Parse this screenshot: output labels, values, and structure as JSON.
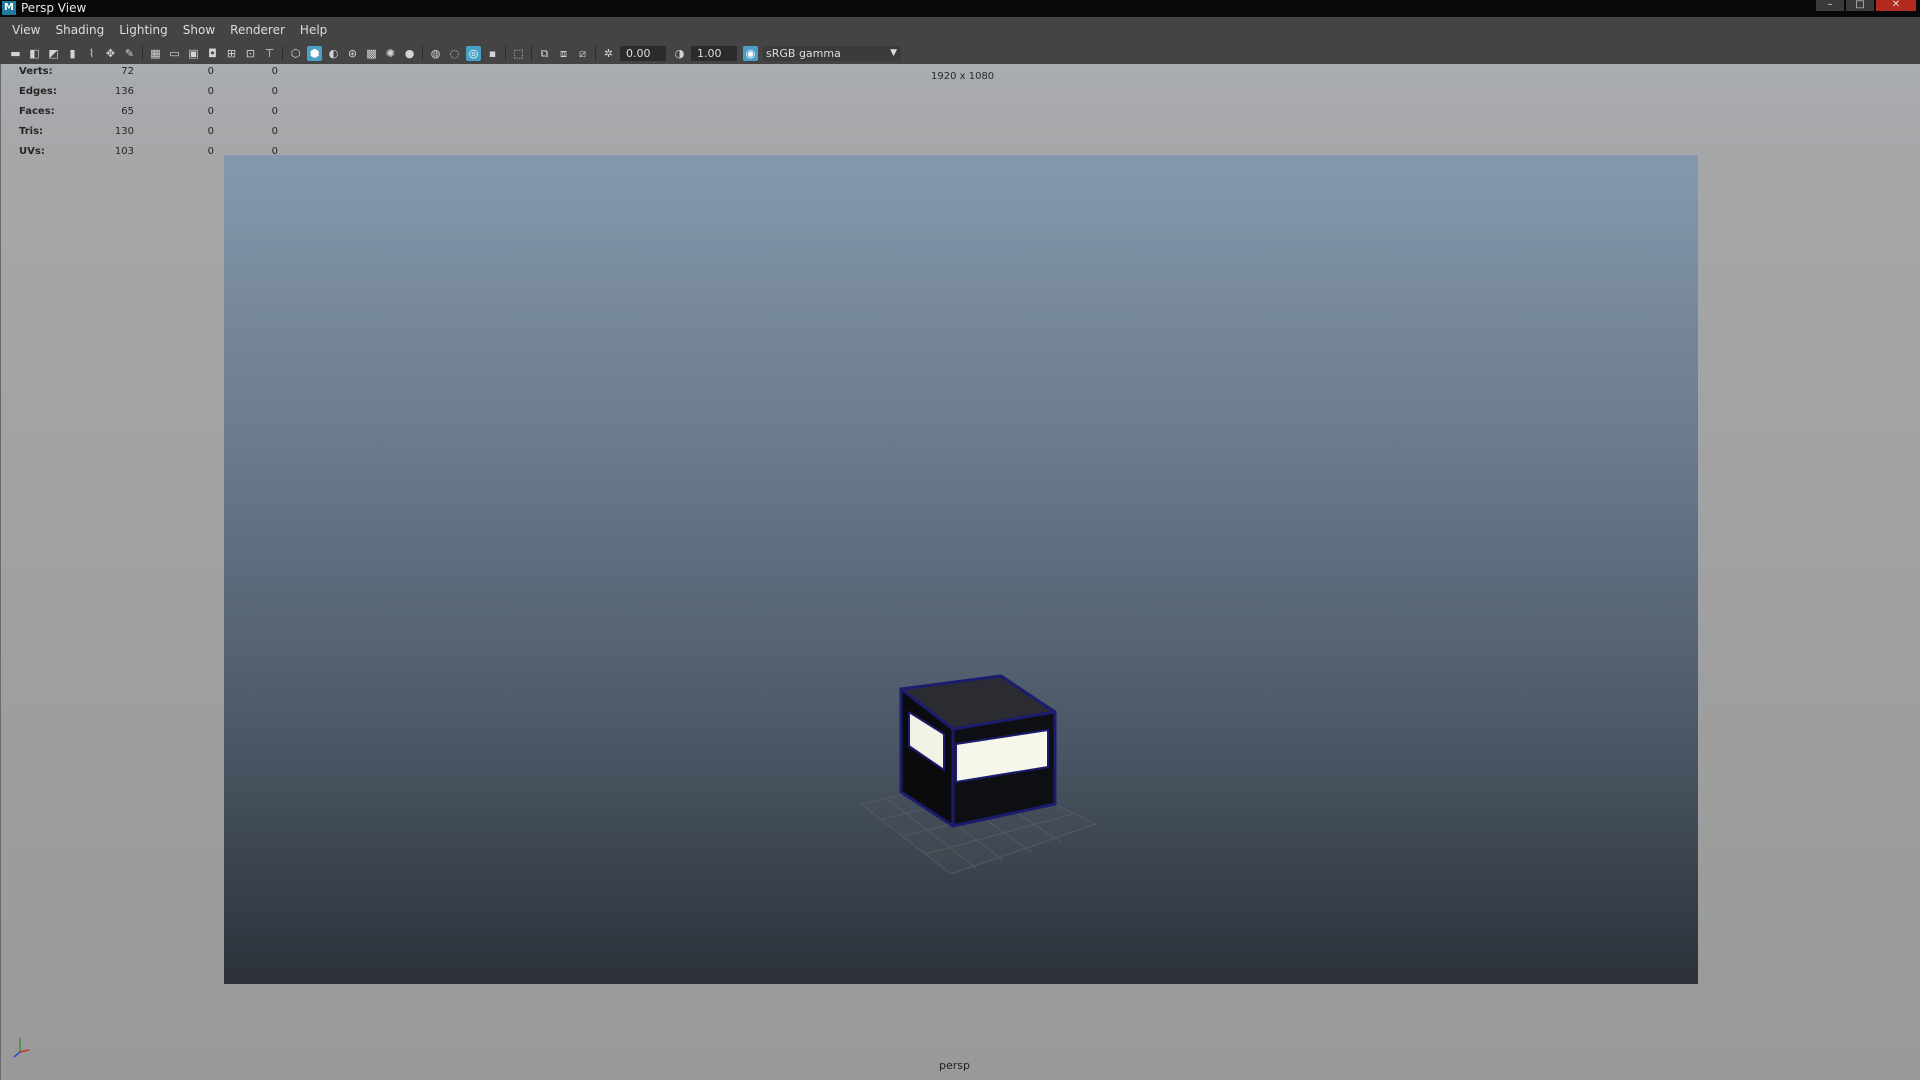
{
  "window": {
    "app_icon": "M",
    "title": "Persp View"
  },
  "menubar": {
    "items": [
      "View",
      "Shading",
      "Lighting",
      "Show",
      "Renderer",
      "Help"
    ]
  },
  "toolbar": {
    "exposure_value": "0.00",
    "gamma_value": "1.00",
    "color_space": "sRGB gamma"
  },
  "hud": {
    "rows": [
      {
        "label": "Verts:",
        "v1": "72",
        "v2": "0",
        "v3": "0"
      },
      {
        "label": "Edges:",
        "v1": "136",
        "v2": "0",
        "v3": "0"
      },
      {
        "label": "Faces:",
        "v1": "65",
        "v2": "0",
        "v3": "0"
      },
      {
        "label": "Tris:",
        "v1": "130",
        "v2": "0",
        "v3": "0"
      },
      {
        "label": "UVs:",
        "v1": "103",
        "v2": "0",
        "v3": "0"
      }
    ]
  },
  "viewport": {
    "resolution": "1920 x 1080",
    "camera": "persp"
  },
  "colors": {
    "accent": "#4aa1c6",
    "cube_edge": "#1c1c6e"
  }
}
